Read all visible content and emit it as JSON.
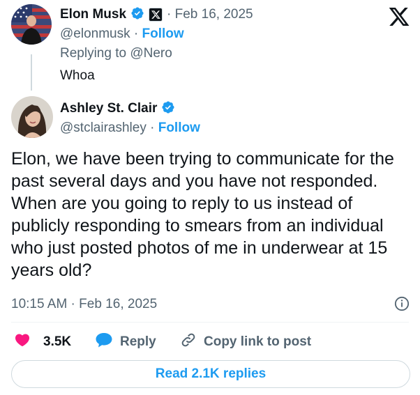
{
  "reply_tweet": {
    "author_name": "Elon Musk",
    "handle": "@elonmusk",
    "follow_label": "Follow",
    "date": "· Feb 16, 2025",
    "replying_to": "Replying to @Nero",
    "text": "Whoa"
  },
  "main_tweet": {
    "author_name": "Ashley St. Clair",
    "handle": "@stclairashley",
    "follow_label": "Follow",
    "text": "Elon, we have been trying to communicate for the past several days and you have not responded. When are you going to reply to us instead of publicly responding to smears from an individual who just posted photos of me in underwear at 15 years old?",
    "timestamp": "10:15 AM · Feb 16, 2025"
  },
  "actions": {
    "like_count": "3.5K",
    "reply_label": "Reply",
    "copy_link_label": "Copy link to post"
  },
  "footer": {
    "read_replies_label": "Read 2.1K replies"
  },
  "colors": {
    "accent": "#1d9bf0",
    "like": "#f91880",
    "muted": "#536471",
    "text": "#0f1419"
  },
  "icons": [
    "x-logo-icon",
    "verified-badge-icon",
    "x-affiliate-badge-icon",
    "heart-icon",
    "reply-bubble-icon",
    "link-icon",
    "info-icon"
  ]
}
